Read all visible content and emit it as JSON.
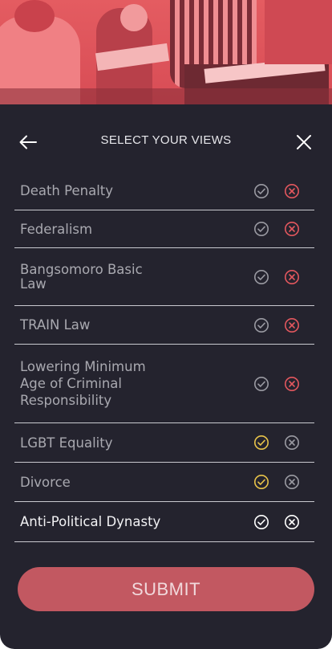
{
  "header": {
    "title": "SELECT YOUR VIEWS"
  },
  "colors": {
    "background": "#24232e",
    "accent": "#e2575e",
    "check_selected": "#e8c34a",
    "divider": "#c9c9cf",
    "submit": "#c25861"
  },
  "topics": [
    {
      "label": "Death Penalty",
      "selection": "disagree"
    },
    {
      "label": "Federalism",
      "selection": "disagree"
    },
    {
      "label": "Bangsomoro Basic\nLaw",
      "selection": "disagree"
    },
    {
      "label": "TRAIN Law",
      "selection": "disagree"
    },
    {
      "label": "Lowering  Minimum\nAge of Criminal\nResponsibility",
      "selection": "disagree"
    },
    {
      "label": "LGBT Equality",
      "selection": "agree"
    },
    {
      "label": "Divorce",
      "selection": "agree"
    },
    {
      "label": "Anti-Political Dynasty",
      "selection": "none"
    }
  ],
  "submit_label": "SUBMIT"
}
